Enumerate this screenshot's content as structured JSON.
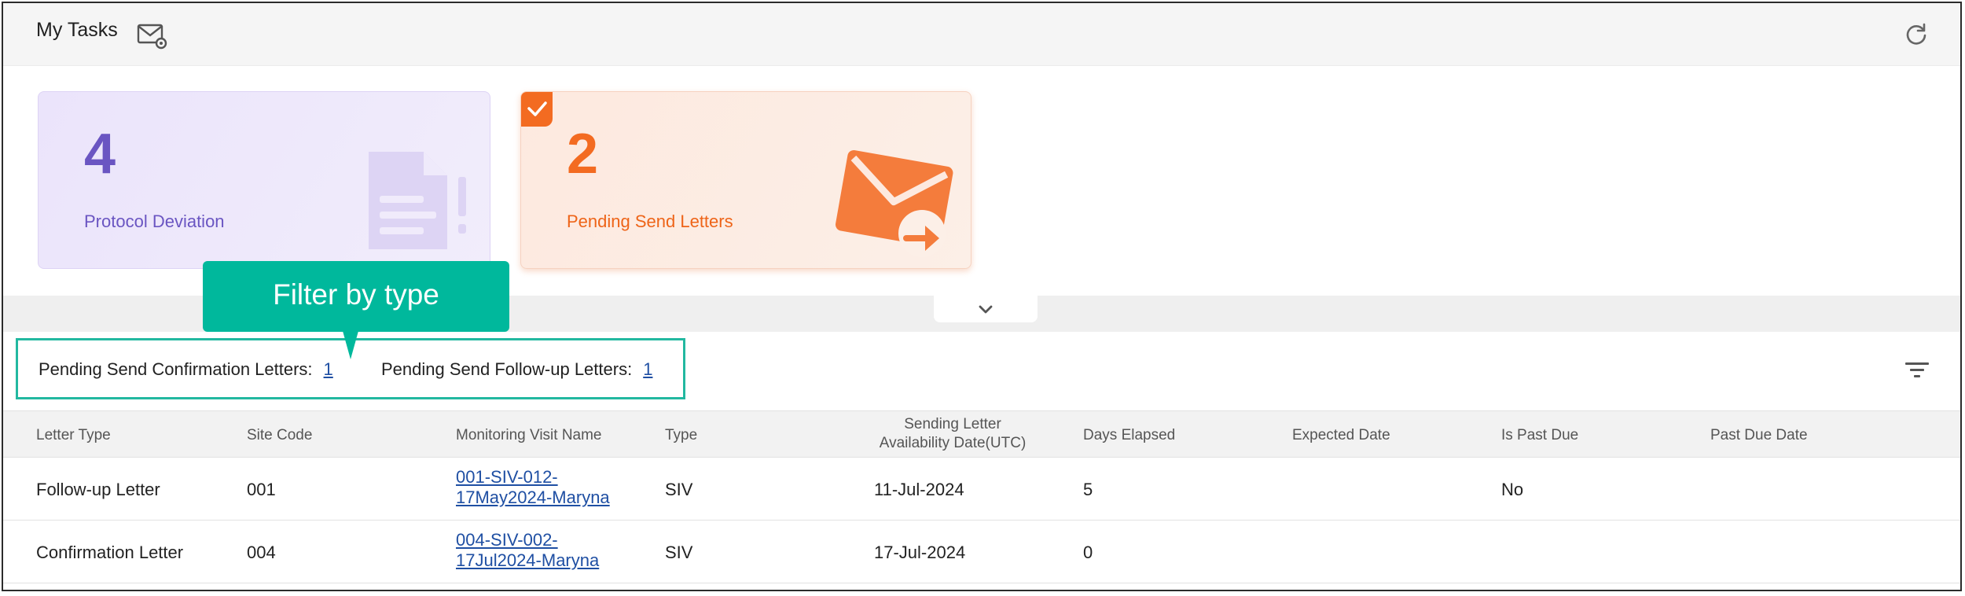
{
  "header": {
    "title": "My Tasks",
    "mail_icon": "mail-settings-icon",
    "refresh_icon": "refresh-icon"
  },
  "cards": {
    "deviation": {
      "count": "4",
      "label": "Protocol Deviation",
      "icon": "document-alert-icon",
      "color": "#6a55c2"
    },
    "letters": {
      "count": "2",
      "label": "Pending Send Letters",
      "icon": "mail-send-icon",
      "color": "#f36b21",
      "selected": true
    }
  },
  "tooltip": {
    "text": "Filter by type"
  },
  "filters": {
    "confirmation_label": "Pending Send Confirmation Letters:",
    "confirmation_count": "1",
    "followup_label": "Pending Send Follow-up Letters:",
    "followup_count": "1",
    "filter_icon": "filter-lines-icon"
  },
  "table": {
    "columns": {
      "letter_type": "Letter Type",
      "site_code": "Site Code",
      "visit_name": "Monitoring Visit Name",
      "type": "Type",
      "availability_line1": "Sending Letter",
      "availability_line2": "Availability Date(UTC)",
      "days_elapsed": "Days Elapsed",
      "expected_date": "Expected Date",
      "is_past_due": "Is Past Due",
      "past_due_date": "Past Due Date"
    },
    "rows": [
      {
        "letter_type": "Follow-up Letter",
        "site_code": "001",
        "visit_line1": "001-SIV-012-",
        "visit_line2": "17May2024-Maryna",
        "type": "SIV",
        "availability": "11-Jul-2024",
        "days_elapsed": "5",
        "expected_date": "",
        "is_past_due": "No",
        "past_due_date": ""
      },
      {
        "letter_type": "Confirmation Letter",
        "site_code": "004",
        "visit_line1": "004-SIV-002-",
        "visit_line2": "17Jul2024-Maryna",
        "type": "SIV",
        "availability": "17-Jul-2024",
        "days_elapsed": "0",
        "expected_date": "",
        "is_past_due": "",
        "past_due_date": ""
      }
    ]
  }
}
